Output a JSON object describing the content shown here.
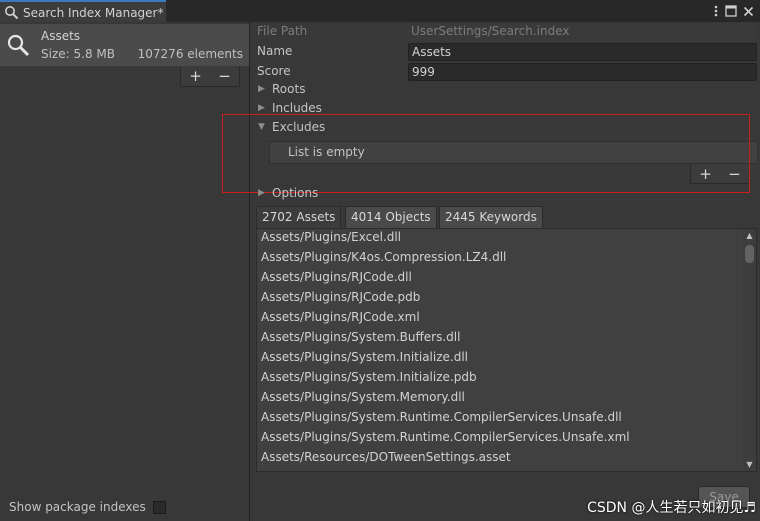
{
  "window": {
    "tab_title": "Search Index Manager*"
  },
  "left": {
    "index": {
      "name": "Assets",
      "size": "Size: 5.8 MB",
      "count": "107276 elements"
    },
    "add_label": "+",
    "remove_label": "−",
    "show_packages_label": "Show package indexes",
    "show_packages_checked": false
  },
  "props": {
    "file_path_label": "File Path",
    "file_path_value": "UserSettings/Search.index",
    "name_label": "Name",
    "name_value": "Assets",
    "score_label": "Score",
    "score_value": "999",
    "roots_label": "Roots",
    "includes_label": "Includes",
    "excludes_label": "Excludes",
    "excludes_empty": "List is empty",
    "options_label": "Options"
  },
  "excludes_buttons": {
    "add": "+",
    "remove": "−"
  },
  "tabs": [
    "2702 Assets",
    "4014 Objects",
    "2445 Keywords"
  ],
  "assets": [
    "Assets/Plugins/Excel.dll",
    "Assets/Plugins/K4os.Compression.LZ4.dll",
    "Assets/Plugins/RJCode.dll",
    "Assets/Plugins/RJCode.pdb",
    "Assets/Plugins/RJCode.xml",
    "Assets/Plugins/System.Buffers.dll",
    "Assets/Plugins/System.Initialize.dll",
    "Assets/Plugins/System.Initialize.pdb",
    "Assets/Plugins/System.Memory.dll",
    "Assets/Plugins/System.Runtime.CompilerServices.Unsafe.dll",
    "Assets/Plugins/System.Runtime.CompilerServices.Unsafe.xml",
    "Assets/Resources/DOTweenSettings.asset"
  ],
  "save_label": "Save",
  "watermark": "CSDN @人生若只如初见♬",
  "colors": {
    "accent": "#3a79bb",
    "highlight": "#c81e1e",
    "background": "#383838"
  }
}
